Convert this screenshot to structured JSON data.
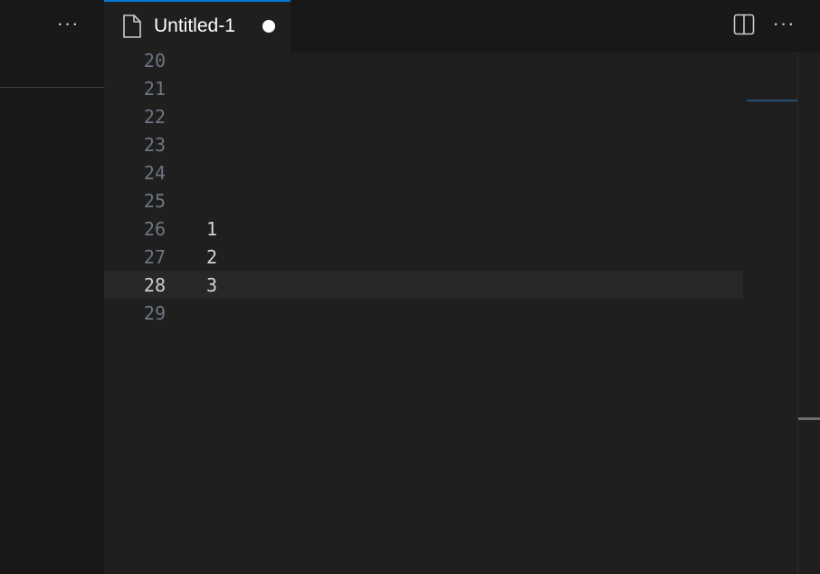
{
  "sidebar": {
    "more_label": "···"
  },
  "tabs": [
    {
      "title": "Untitled-1",
      "icon": "file-icon",
      "dirty": true
    }
  ],
  "editor_actions": {
    "split_icon": "split-editor-icon",
    "more_label": "···"
  },
  "editor": {
    "line_numbers": [
      "20",
      "21",
      "22",
      "23",
      "24",
      "25",
      "26",
      "27",
      "28",
      "29"
    ],
    "lines": [
      "",
      "",
      "",
      "",
      "",
      "",
      "1",
      "2",
      "3",
      ""
    ],
    "active_line": "28"
  },
  "colors": {
    "accent": "#0078d4",
    "editor_background": "#1f1f1f",
    "sidebar_background": "#181818",
    "line_number": "#6e7681",
    "active_line_number": "#cccccc",
    "current_line_highlight": "#282828"
  }
}
